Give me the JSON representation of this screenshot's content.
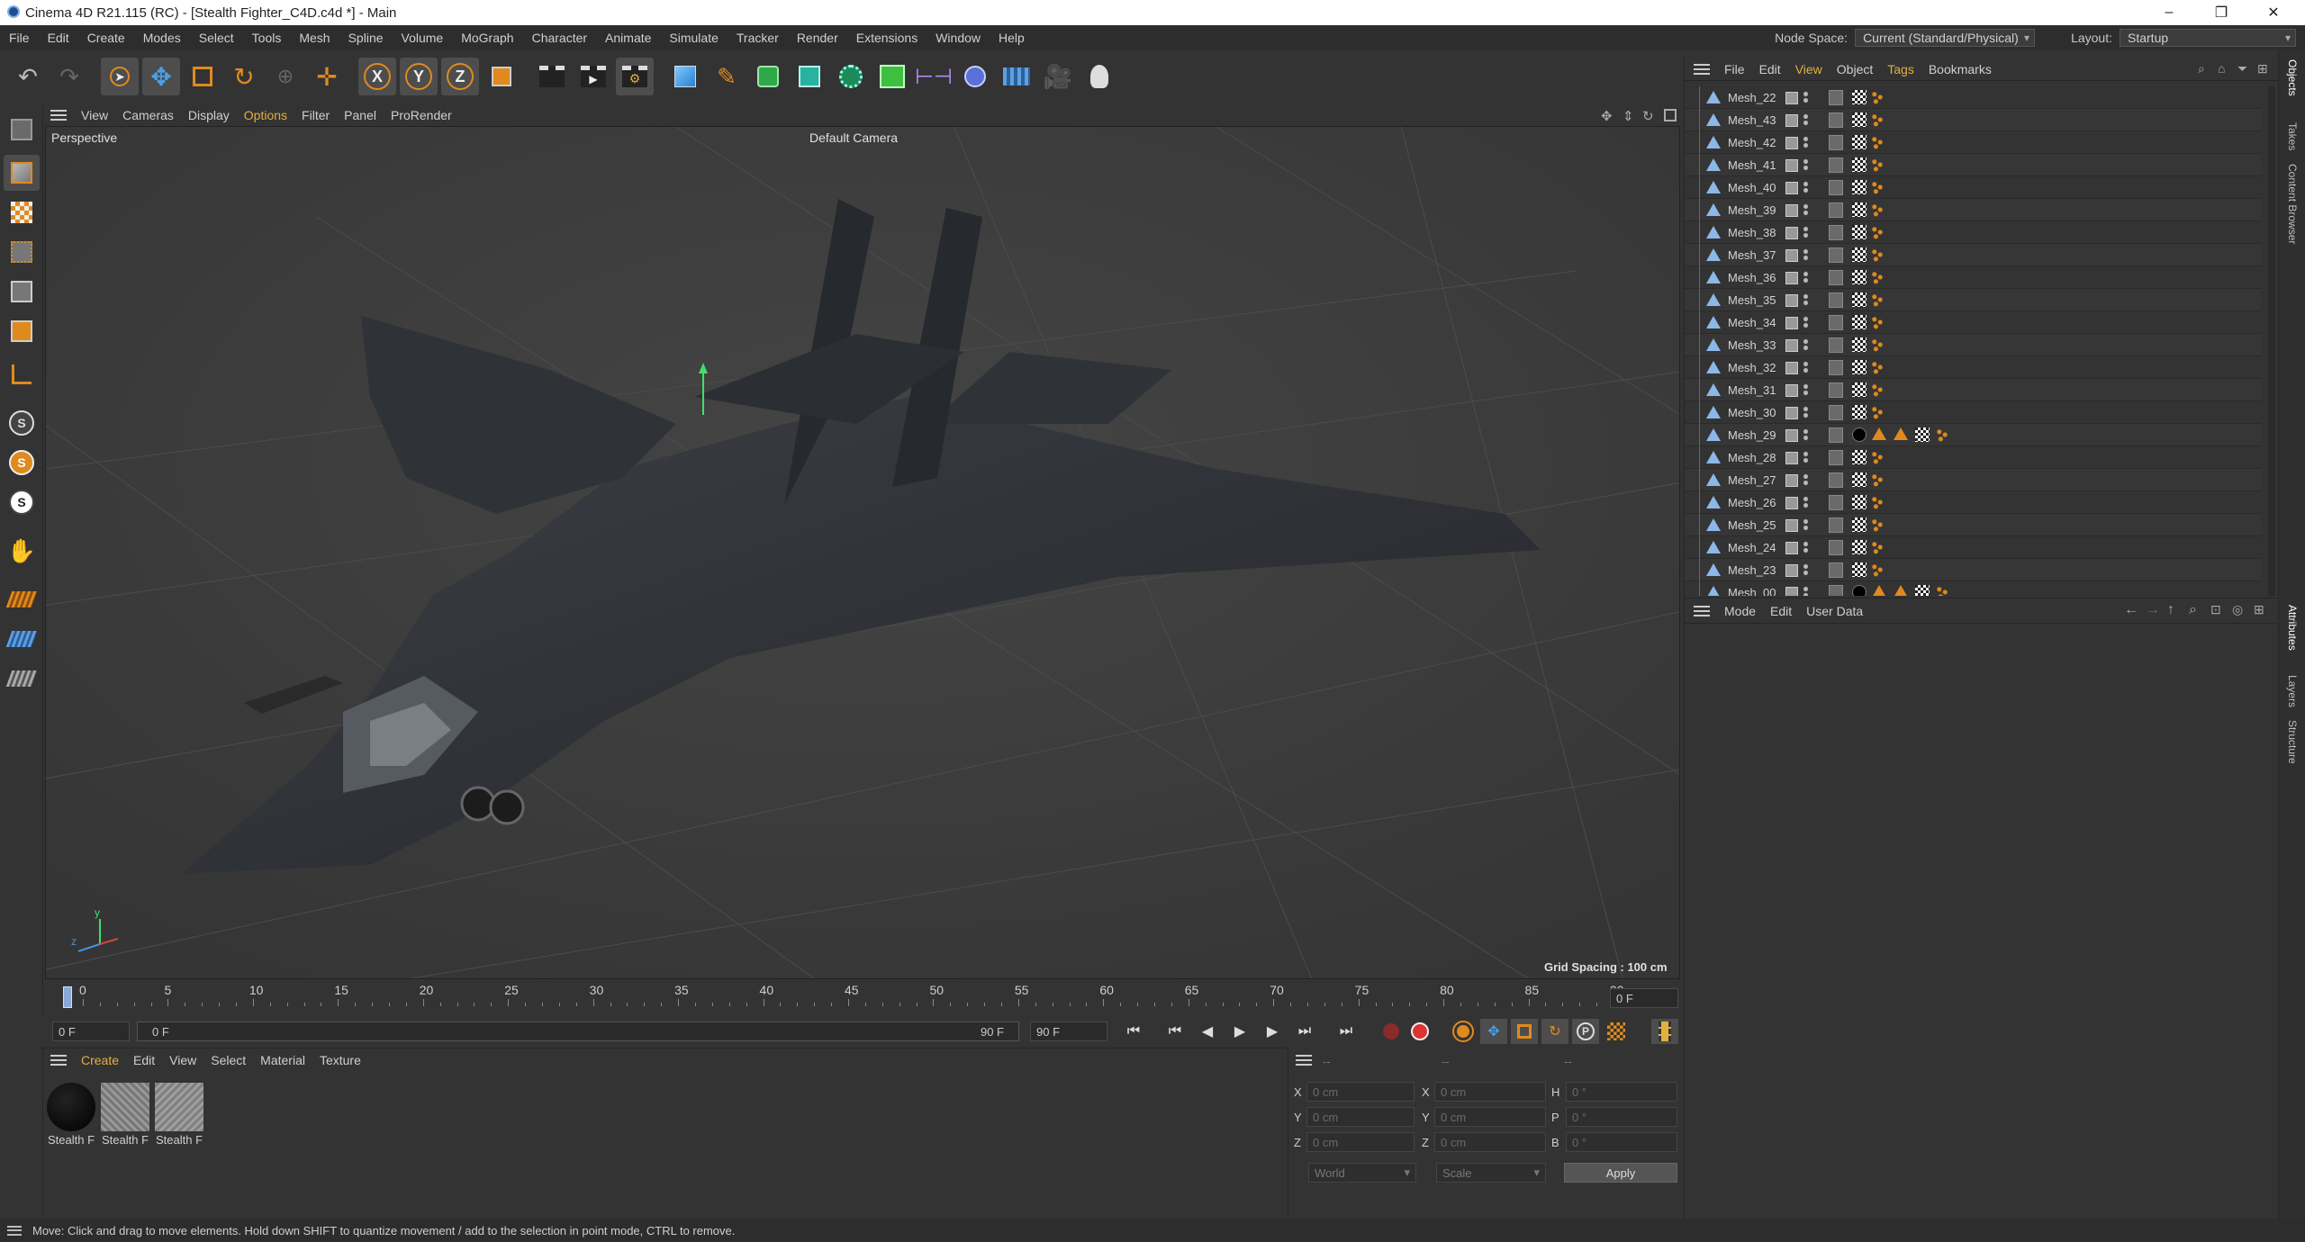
{
  "window": {
    "title": "Cinema 4D R21.115 (RC) - [Stealth Fighter_C4D.c4d *] - Main",
    "minimize": "–",
    "maximize": "❐",
    "close": "✕"
  },
  "menubar": {
    "items": [
      "File",
      "Edit",
      "Create",
      "Modes",
      "Select",
      "Tools",
      "Mesh",
      "Spline",
      "Volume",
      "MoGraph",
      "Character",
      "Animate",
      "Simulate",
      "Tracker",
      "Render",
      "Extensions",
      "Window",
      "Help"
    ],
    "node_space_label": "Node Space:",
    "node_space_value": "Current (Standard/Physical)",
    "layout_label": "Layout:",
    "layout_value": "Startup"
  },
  "viewport": {
    "menu": [
      "View",
      "Cameras",
      "Display",
      "Options",
      "Filter",
      "Panel",
      "ProRender"
    ],
    "name": "Perspective",
    "camera": "Default Camera",
    "grid_spacing": "Grid Spacing : 100 cm",
    "axis_y": "y",
    "axis_z": "z"
  },
  "timeline": {
    "ticks": [
      "0",
      "5",
      "10",
      "15",
      "20",
      "25",
      "30",
      "35",
      "40",
      "45",
      "50",
      "55",
      "60",
      "65",
      "70",
      "75",
      "80",
      "85",
      "90"
    ],
    "current_frame_right": "0 F",
    "start_field": "0 F",
    "range_start": "0 F",
    "range_end": "90 F",
    "end_field": "90 F"
  },
  "materials": {
    "menu": [
      "Create",
      "Edit",
      "View",
      "Select",
      "Material",
      "Texture"
    ],
    "items": [
      {
        "label": "Stealth F"
      },
      {
        "label": "Stealth F"
      },
      {
        "label": "Stealth F"
      }
    ]
  },
  "coordinates": {
    "header": [
      "--",
      "--",
      "--"
    ],
    "rows": [
      {
        "a": "X",
        "av": "0 cm",
        "b": "X",
        "bv": "0 cm",
        "c": "H",
        "cv": "0 °"
      },
      {
        "a": "Y",
        "av": "0 cm",
        "b": "Y",
        "bv": "0 cm",
        "c": "P",
        "cv": "0 °"
      },
      {
        "a": "Z",
        "av": "0 cm",
        "b": "Z",
        "bv": "0 cm",
        "c": "B",
        "cv": "0 °"
      }
    ],
    "mode_world": "World",
    "mode_scale": "Scale",
    "apply": "Apply"
  },
  "objects": {
    "menu": [
      "File",
      "Edit",
      "View",
      "Object",
      "Tags",
      "Bookmarks"
    ],
    "rows": [
      "Mesh_22",
      "Mesh_43",
      "Mesh_42",
      "Mesh_41",
      "Mesh_40",
      "Mesh_39",
      "Mesh_38",
      "Mesh_37",
      "Mesh_36",
      "Mesh_35",
      "Mesh_34",
      "Mesh_33",
      "Mesh_32",
      "Mesh_31",
      "Mesh_30",
      "Mesh_29",
      "Mesh_28",
      "Mesh_27",
      "Mesh_26",
      "Mesh_25",
      "Mesh_24",
      "Mesh_23",
      "Mesh_00"
    ]
  },
  "attributes": {
    "menu": [
      "Mode",
      "Edit",
      "User Data"
    ]
  },
  "sidetabs": {
    "top": [
      "Objects",
      "Takes",
      "Content Browser"
    ],
    "bottom": [
      "Attributes",
      "Layers",
      "Structure"
    ]
  },
  "status": {
    "text": "Move: Click and drag to move elements. Hold down SHIFT to quantize movement / add to the selection in point mode, CTRL to remove."
  },
  "colors": {
    "accent": "#e08a1e",
    "bg": "#333333",
    "viewport": "#3b3b3b",
    "active_menu": "#e0b040"
  }
}
